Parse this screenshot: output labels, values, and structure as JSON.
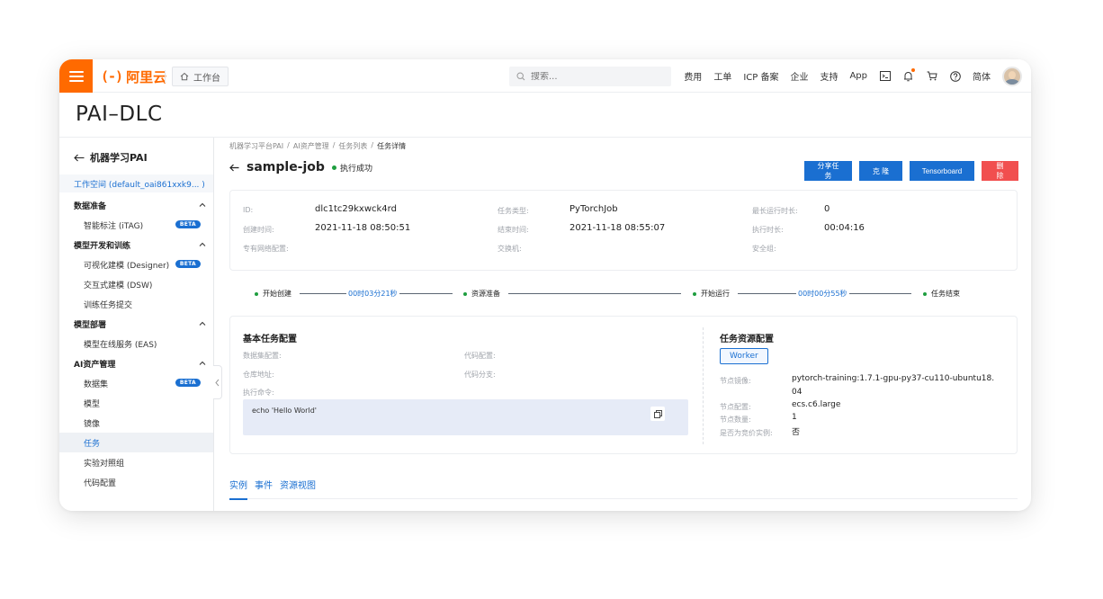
{
  "topbar": {
    "logo_mark": "(-)",
    "logo_text": "阿里云",
    "workbench": "工作台",
    "search_placeholder": "搜索...",
    "nav": [
      "费用",
      "工单",
      "ICP 备案",
      "企业",
      "支持",
      "App"
    ],
    "lang": "简体"
  },
  "product_title": "PAI–DLC",
  "sidebar": {
    "back_label": "机器学习PAI",
    "workspace": "工作空间 (default_oai861xxk9... )",
    "items": [
      {
        "label": "数据准备",
        "group": true
      },
      {
        "label": "智能标注 (iTAG)",
        "beta": "BETA"
      },
      {
        "label": "模型开发和训练",
        "group": true
      },
      {
        "label": "可视化建模 (Designer)",
        "beta": "BETA"
      },
      {
        "label": "交互式建模 (DSW)"
      },
      {
        "label": "训练任务提交"
      },
      {
        "label": "模型部署",
        "group": true
      },
      {
        "label": "模型在线服务 (EAS)"
      },
      {
        "label": "AI资产管理",
        "group": true
      },
      {
        "label": "数据集",
        "beta": "BETA"
      },
      {
        "label": "模型"
      },
      {
        "label": "镜像"
      },
      {
        "label": "任务",
        "active": true
      },
      {
        "label": "实验对照组"
      },
      {
        "label": "代码配置"
      }
    ]
  },
  "breadcrumb": [
    "机器学习平台PAI",
    "AI资产管理",
    "任务列表",
    "任务详情"
  ],
  "job": {
    "name": "sample-job",
    "status": "执行成功",
    "actions": {
      "share": "分享任务",
      "clone": "克 隆",
      "tensorboard": "Tensorboard",
      "delete": "删 除"
    }
  },
  "info": {
    "id_label": "ID:",
    "id": "dlc1tc29kxwck4rd",
    "created_label": "创建时间:",
    "created": "2021-11-18 08:50:51",
    "net_label": "专有网络配置:",
    "type_label": "任务类型:",
    "type": "PyTorchJob",
    "ended_label": "结束时间:",
    "ended": "2021-11-18 08:55:07",
    "switch_label": "交换机:",
    "maxrun_label": "最长运行时长:",
    "maxrun": "0",
    "exec_label": "执行时长:",
    "exec": "00:04:16",
    "secgroup_label": "安全组:"
  },
  "timeline": {
    "nodes": [
      "开始创建",
      "资源准备",
      "开始运行",
      "任务结束"
    ],
    "dur1": "00时03分21秒",
    "dur2": "00时00分55秒"
  },
  "config": {
    "basic_title": "基本任务配置",
    "dataset_label": "数据集配置:",
    "code_label": "代码配置:",
    "repo_label": "仓库地址:",
    "branch_label": "代码分支:",
    "cmd_label": "执行命令:",
    "cmd": "echo 'Hello World'",
    "res_title": "任务资源配置",
    "worker": "Worker",
    "image_label": "节点镜像:",
    "image_line1": "pytorch-training:1.7.1-gpu-py37-cu110-ubuntu18.",
    "image_line2": "04",
    "spec_label": "节点配置:",
    "spec": "ecs.c6.large",
    "count_label": "节点数量:",
    "count": "1",
    "spot_label": "是否为竞价实例:",
    "spot": "否"
  },
  "tabs": [
    "实例",
    "事件",
    "资源视图"
  ],
  "colors": {
    "brand": "#ff6a00",
    "primary": "#1a6fd1",
    "danger": "#f14f4f",
    "success": "#1e9e3f"
  }
}
